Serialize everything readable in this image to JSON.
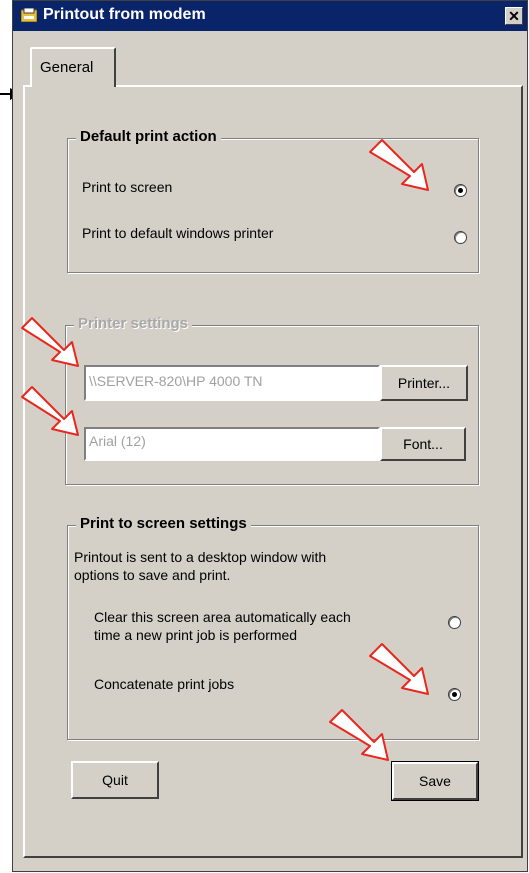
{
  "window": {
    "title": "Printout from modem",
    "close_glyph": "✕"
  },
  "tab": {
    "label": "General"
  },
  "default_print_action": {
    "legend": "Default print action",
    "options": [
      {
        "label": "Print to screen",
        "checked": true
      },
      {
        "label": "Print to default windows printer",
        "checked": false
      }
    ]
  },
  "printer_settings": {
    "legend": "Printer settings",
    "printer_value": "\\\\SERVER-820\\HP 4000 TN",
    "printer_button": "Printer...",
    "font_value": "Arial (12)",
    "font_button": "Font..."
  },
  "screen_settings": {
    "legend": "Print to screen settings",
    "description": "Printout is sent to a desktop window with options to save and print.",
    "options": [
      {
        "label": "Clear this screen area automatically each time a new print job is performed",
        "checked": false
      },
      {
        "label": "Concatenate print jobs",
        "checked": true
      }
    ]
  },
  "buttons": {
    "quit": "Quit",
    "save": "Save"
  },
  "annotation_color": "#e8281e"
}
